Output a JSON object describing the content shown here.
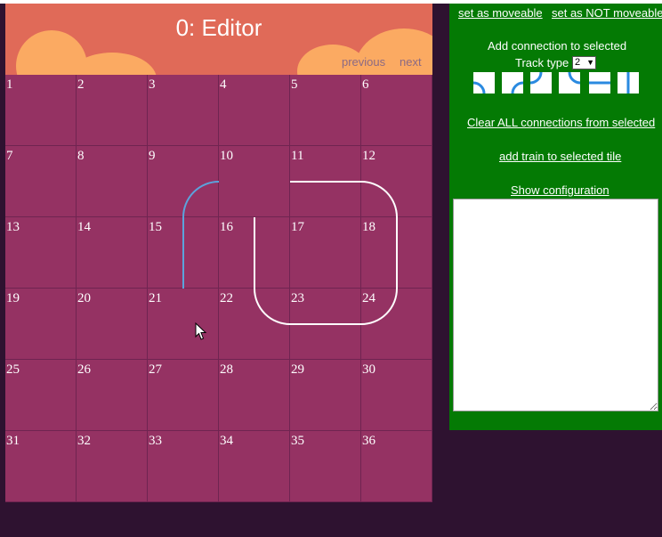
{
  "header": {
    "title": "0: Editor",
    "previous_label": "previous",
    "next_label": "next"
  },
  "grid": {
    "rows": 6,
    "cols": 6,
    "tiles": [
      "1",
      "2",
      "3",
      "4",
      "5",
      "6",
      "7",
      "8",
      "9",
      "10",
      "11",
      "12",
      "13",
      "14",
      "15",
      "16",
      "17",
      "18",
      "19",
      "20",
      "21",
      "22",
      "23",
      "24",
      "25",
      "26",
      "27",
      "28",
      "29",
      "30",
      "31",
      "32",
      "33",
      "34",
      "35",
      "36"
    ]
  },
  "panel": {
    "set_moveable": "set as moveable",
    "set_not_moveable": "set as NOT moveable",
    "add_connection": "Add connection to selected",
    "track_type_label": "Track type",
    "track_type_value": "2",
    "track_buttons": [
      "track-corner-left-bottom-icon",
      "track-corner-right-bottom-icon",
      "track-corner-right-top-icon",
      "track-corner-left-top-icon",
      "track-straight-horizontal-icon",
      "track-straight-vertical-icon"
    ],
    "clear_connections": "Clear ALL connections from selected",
    "add_train": "add train to selected tile",
    "show_config": "Show configuration",
    "config_text": ""
  },
  "colors": {
    "header_bg": "#e06a58",
    "cloud": "#fbaa62",
    "tile_bg": "#953263",
    "panel_bg": "#047a04",
    "page_bg": "#2e1230",
    "track_blue": "#5ba3dc",
    "track_white": "#ffffff"
  }
}
